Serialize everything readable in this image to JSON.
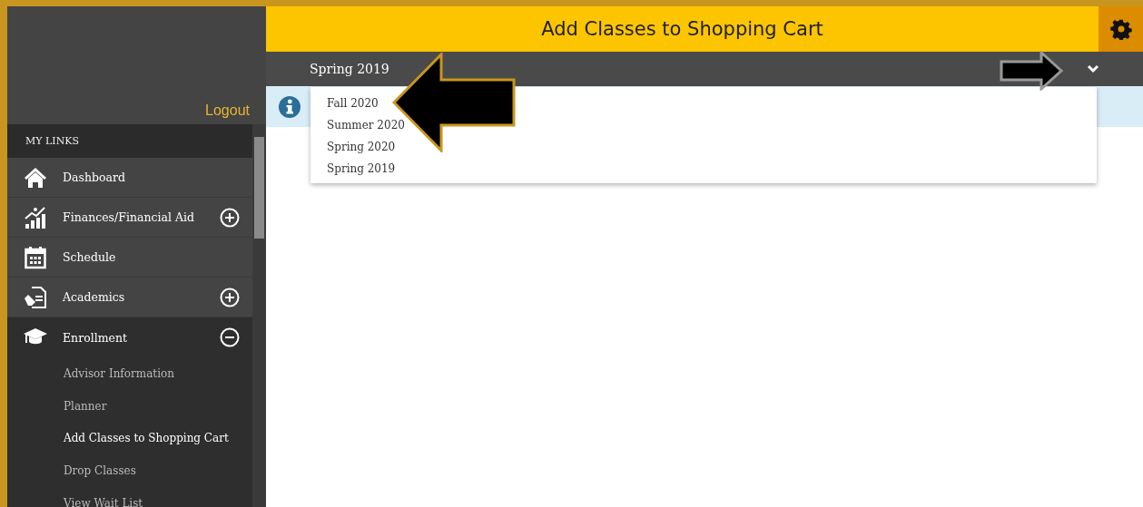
{
  "header": {
    "title": "Add Classes to Shopping Cart"
  },
  "term_bar": {
    "term": "Spring 2019",
    "expanded": true
  },
  "term_dropdown": {
    "options": [
      {
        "label": "Fall 2020"
      },
      {
        "label": "Summer 2020"
      },
      {
        "label": "Spring 2020"
      },
      {
        "label": "Spring 2019"
      }
    ]
  },
  "sidebar": {
    "logout": "Logout",
    "section": "MY LINKS",
    "items": [
      {
        "label": "Dashboard",
        "kind": "house"
      },
      {
        "label": "Finances/Financial Aid",
        "kind": "chart",
        "expanded": false
      },
      {
        "label": "Schedule",
        "kind": "calendar"
      },
      {
        "label": "Academics",
        "kind": "document",
        "expanded": false
      },
      {
        "label": "Enrollment",
        "kind": "cap",
        "expanded": true,
        "children": [
          {
            "label": "Advisor Information",
            "selected": false
          },
          {
            "label": "Planner",
            "selected": false
          },
          {
            "label": "Add Classes to Shopping Cart",
            "selected": true
          },
          {
            "label": "Drop Classes",
            "selected": false
          },
          {
            "label": "View Wait List",
            "selected": false
          }
        ]
      }
    ]
  }
}
